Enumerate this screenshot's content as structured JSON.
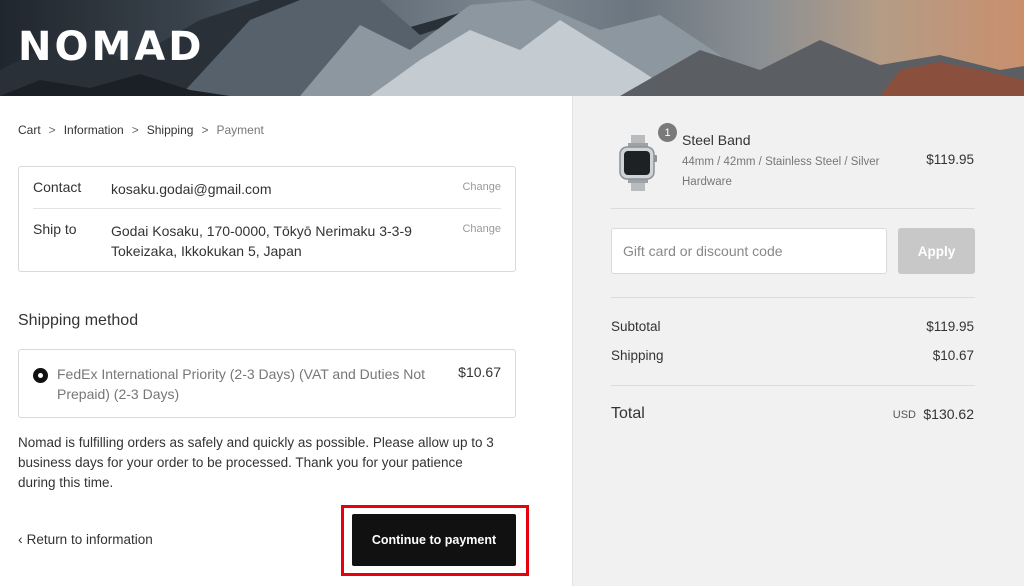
{
  "header": {
    "logo": "NOMAD"
  },
  "breadcrumb": {
    "items": [
      "Cart",
      "Information",
      "Shipping",
      "Payment"
    ],
    "separator": ">"
  },
  "review": {
    "contact_label": "Contact",
    "contact_value": "kosaku.godai@gmail.com",
    "ship_label": "Ship to",
    "ship_line1": "Godai Kosaku, 170-0000, Tōkyō Nerimaku 3-3-9",
    "ship_line2": "Tokeizaka, Ikkokukan 5, Japan",
    "change_label": "Change"
  },
  "shipping_method": {
    "title": "Shipping method",
    "option_line1": "FedEx International Priority (2-3 Days) (VAT and Duties Not",
    "option_line2": "Prepaid) (2-3 Days)",
    "option_price": "$10.67"
  },
  "notice": {
    "line1": "Nomad is fulfilling orders as safely and quickly as possible. Please allow up to 3",
    "line2": "business days for your order to be processed. Thank you for your patience",
    "line3": "during this time."
  },
  "actions": {
    "return_label": "Return to information",
    "continue_label": "Continue to payment"
  },
  "order": {
    "quantity": "1",
    "product_name": "Steel Band",
    "variant_line1": "44mm / 42mm / Stainless Steel / Silver",
    "variant_line2": "Hardware",
    "product_price": "$119.95",
    "discount_placeholder": "Gift card or discount code",
    "apply_label": "Apply",
    "subtotal_label": "Subtotal",
    "subtotal_value": "$119.95",
    "shipping_label": "Shipping",
    "shipping_value": "$10.67",
    "total_label": "Total",
    "currency": "USD",
    "total_value": "$130.62"
  },
  "colors": {
    "highlight": "#e8000b",
    "button": "#111111",
    "sidebar_bg": "#f1f1f1"
  }
}
